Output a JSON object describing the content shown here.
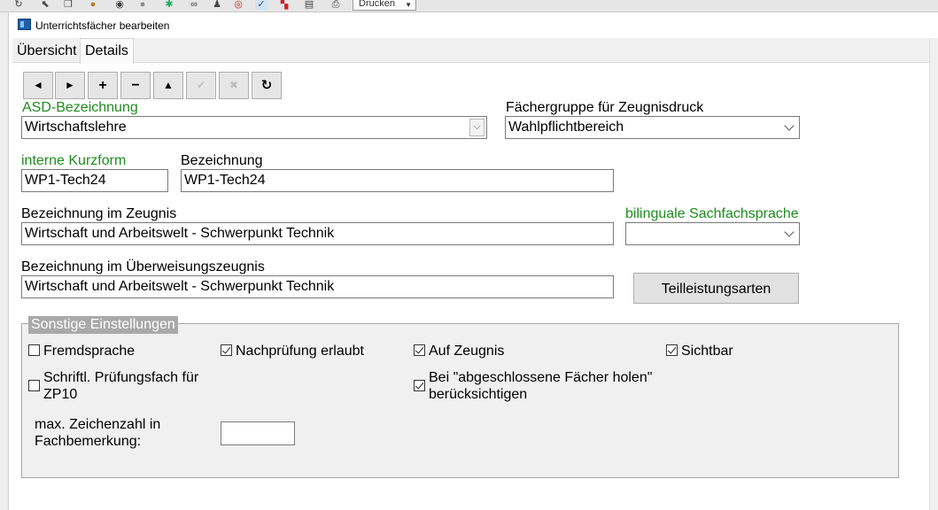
{
  "toolbar": {
    "print_label": "Drucken"
  },
  "window": {
    "title": "Unterrichtsfächer bearbeiten"
  },
  "tabs": [
    {
      "label": "Übersicht"
    },
    {
      "label": "Details"
    }
  ],
  "nav": {
    "first": "◄",
    "next": "►",
    "add": "+",
    "remove": "−",
    "up": "▲",
    "confirm": "✔",
    "cancel": "✖",
    "refresh": "↻"
  },
  "form": {
    "asd_label": "ASD-Bezeichnung",
    "asd_value": "Wirtschaftslehre",
    "faechergruppe_label": "Fächergruppe für Zeugnisdruck",
    "faechergruppe_value": "Wahlpflichtbereich",
    "kurzform_label": "interne Kurzform",
    "kurzform_value": "WP1-Tech24",
    "bezeichnung_label": "Bezeichnung",
    "bezeichnung_value": "WP1-Tech24",
    "zeugnis_label": "Bezeichnung im Zeugnis",
    "zeugnis_value": "Wirtschaft und Arbeitswelt - Schwerpunkt Technik",
    "bilingual_label": "bilinguale Sachfachsprache",
    "bilingual_value": "",
    "ueberweisung_label": "Bezeichnung im Überweisungszeugnis",
    "ueberweisung_value": "Wirtschaft und Arbeitswelt - Schwerpunkt Technik",
    "teilleistungsarten_button": "Teilleistungsarten"
  },
  "sonstige": {
    "title": "Sonstige Einstellungen",
    "fremdsprache": {
      "label": "Fremdsprache",
      "checked": false
    },
    "nachpruefung": {
      "label": "Nachprüfung erlaubt",
      "checked": true
    },
    "auf_zeugnis": {
      "label": "Auf Zeugnis",
      "checked": true
    },
    "sichtbar": {
      "label": "Sichtbar",
      "checked": true
    },
    "pruefungsfach": {
      "label_line1": "Schriftl. Prüfungsfach für",
      "label_line2": "ZP10",
      "checked": false
    },
    "abgeschlossene": {
      "label_line1": "Bei \"abgeschlossene Fächer holen\"",
      "label_line2": "berücksichtigen",
      "checked": true
    },
    "max_zeichen_line1": "max. Zeichenzahl in",
    "max_zeichen_line2": "Fachbemerkung:",
    "max_zeichen_value": ""
  },
  "colors": {
    "required_label": "#1e8c1e",
    "groupbox_title_bg": "#a9a9a9"
  }
}
